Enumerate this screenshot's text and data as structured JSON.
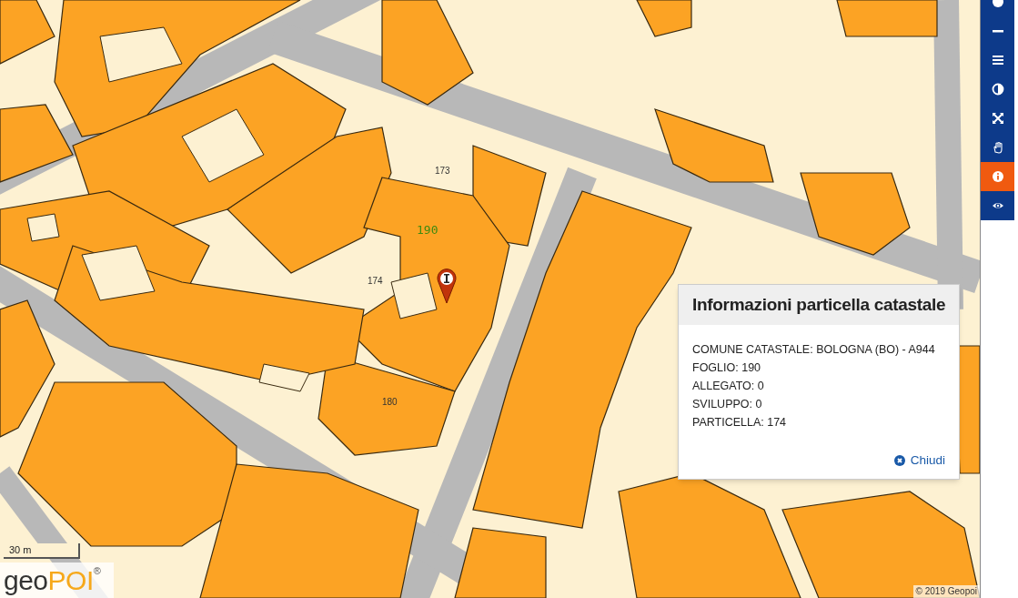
{
  "map": {
    "parcel_labels": [
      {
        "text": "173",
        "kind": "parcel"
      },
      {
        "text": "190",
        "kind": "sheet"
      },
      {
        "text": "174",
        "kind": "parcel"
      },
      {
        "text": "180",
        "kind": "parcel"
      }
    ],
    "scale": "30 m",
    "logo": {
      "first": "geo",
      "second": "POI",
      "mark": "®"
    },
    "attribution": "© 2019 Geopoi"
  },
  "toolbar": [
    {
      "kind": "circle",
      "selected": false
    },
    {
      "kind": "minus",
      "selected": false
    },
    {
      "kind": "menu",
      "selected": false
    },
    {
      "kind": "contrast",
      "selected": false
    },
    {
      "kind": "fullscreen",
      "selected": false
    },
    {
      "kind": "pan",
      "selected": false
    },
    {
      "kind": "info",
      "selected": true
    },
    {
      "kind": "eye",
      "selected": false
    }
  ],
  "popup": {
    "title": "Informazioni particella catastale",
    "lines": [
      "COMUNE CATASTALE: BOLOGNA (BO) - A944",
      "FOGLIO: 190",
      "ALLEGATO: 0",
      "SVILUPPO: 0",
      "PARTICELLA: 174"
    ],
    "close": "Chiudi"
  }
}
